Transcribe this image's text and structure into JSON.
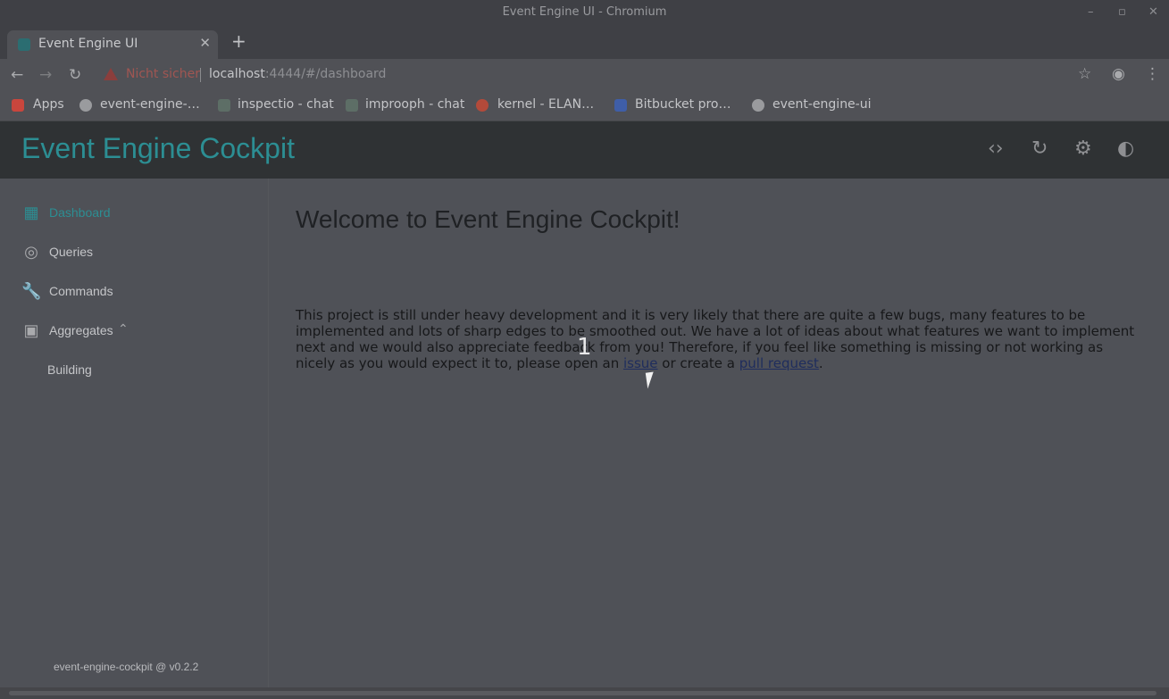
{
  "window": {
    "title": "Event Engine UI - Chromium",
    "controls": [
      "–",
      "▫",
      "✕"
    ]
  },
  "tab": {
    "title": "Event Engine UI",
    "close": "✕",
    "new_tab": "+"
  },
  "omnibox": {
    "warning": "Nicht sicher",
    "url_host": "localhost",
    "url_rest": ":4444/#/dashboard"
  },
  "bookmarks": [
    {
      "label": "Apps",
      "icon": "apps-grid-icon",
      "color": "#c9463d"
    },
    {
      "label": "event-engine-…",
      "icon": "globe-icon",
      "color": "#9a9b9e"
    },
    {
      "label": "inspectio - chat",
      "icon": "chat-app-icon",
      "color": "#5d6e66"
    },
    {
      "label": "improoph - chat",
      "icon": "chat-app-icon",
      "color": "#5d6e66"
    },
    {
      "label": "kernel - ELAN…",
      "icon": "elan-icon",
      "color": "#b34a3a"
    },
    {
      "label": "Bitbucket pro…",
      "icon": "bitbucket-icon",
      "color": "#3f5ea8"
    },
    {
      "label": "event-engine-ui",
      "icon": "globe-icon",
      "color": "#9a9b9e"
    }
  ],
  "app": {
    "title": "Event Engine Cockpit",
    "header_icons": [
      "code-icon",
      "refresh-icon",
      "settings-icon",
      "theme-icon"
    ],
    "accent": "#2c8e93"
  },
  "sidebar": {
    "items": [
      {
        "label": "Dashboard",
        "icon": "dashboard-icon",
        "active": true
      },
      {
        "label": "Queries",
        "icon": "query-icon",
        "active": false
      },
      {
        "label": "Commands",
        "icon": "wrench-icon",
        "active": false
      },
      {
        "label": "Aggregates",
        "icon": "chip-icon",
        "active": false,
        "expanded": true
      }
    ],
    "sub_items": [
      "Building"
    ],
    "version": "event-engine-cockpit @ v0.2.2"
  },
  "main": {
    "heading": "Welcome to Event Engine Cockpit!",
    "intro_prefix": "This project is still under heavy development and it is very likely that there are quite a few bugs, many features to be implemented and lots of sharp edges to be smoothed out. We have a lot of ideas about what features we want to implement next and we would also appreciate feedback from you! Therefore, if you feel like something is missing or not working as nicely as you would expect it to, please open an ",
    "issue_link": "issue",
    "intro_middle": " or create a ",
    "pr_link": "pull request",
    "intro_suffix": ".",
    "overlay_marker": "1"
  }
}
